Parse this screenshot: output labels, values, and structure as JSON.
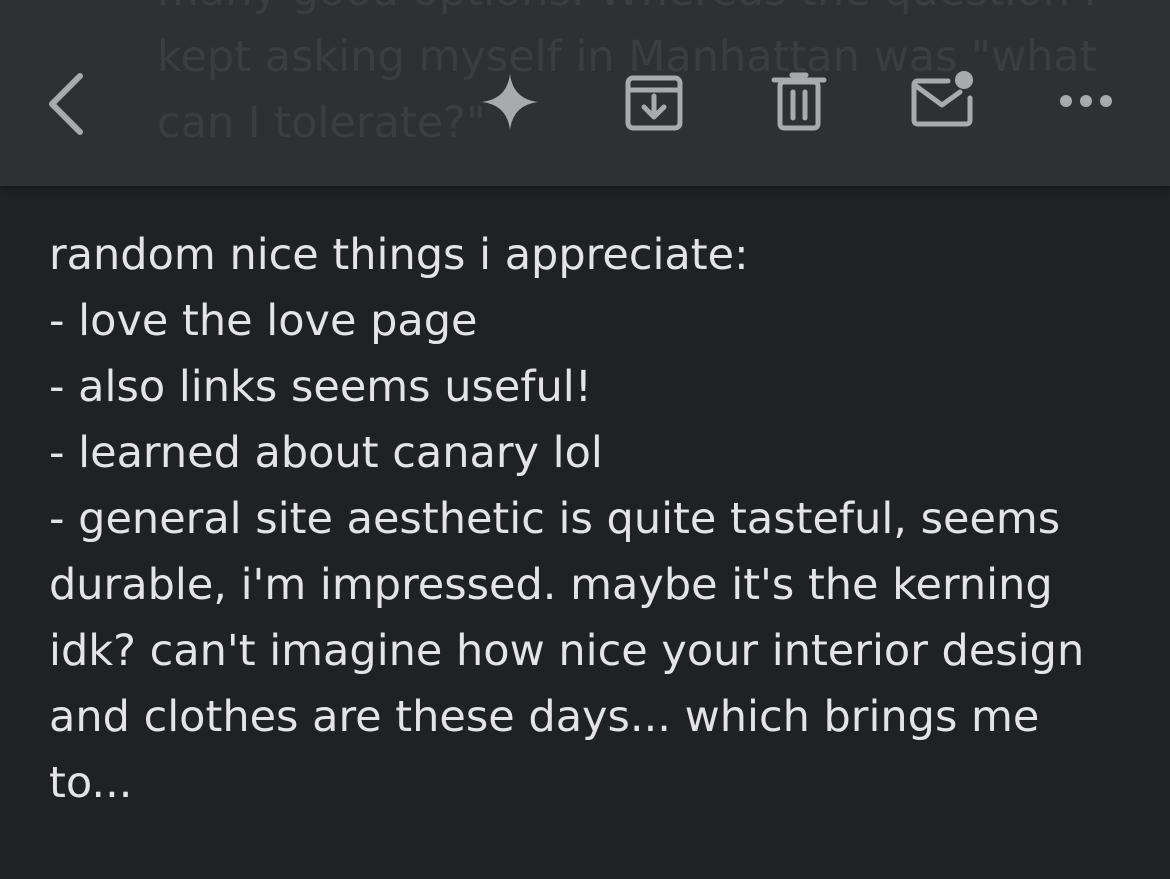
{
  "toolbar": {
    "background_preview": "many good options. Whereas the question I kept asking myself in Manhattan was \"what can I tolerate?\"",
    "icons": {
      "back": "chevron-left-icon",
      "sparkle": "sparkle-icon",
      "archive": "archive-icon",
      "delete": "trash-icon",
      "mark_unread": "mark-unread-icon",
      "more": "more-horizontal-icon"
    }
  },
  "message": {
    "lines": [
      "random nice things i appreciate:",
      "- love the love page",
      "- also links seems useful!",
      "- learned about canary lol",
      "- general site aesthetic is quite tasteful, seems",
      "durable, i'm impressed. maybe it's the kerning",
      "idk? can't imagine how nice your interior design",
      "and clothes are these days... which brings me",
      "to..."
    ]
  },
  "colors": {
    "background": "#202124",
    "toolbar": "#303135",
    "icon": "#a9aaae",
    "text": "#e4e4e6"
  }
}
